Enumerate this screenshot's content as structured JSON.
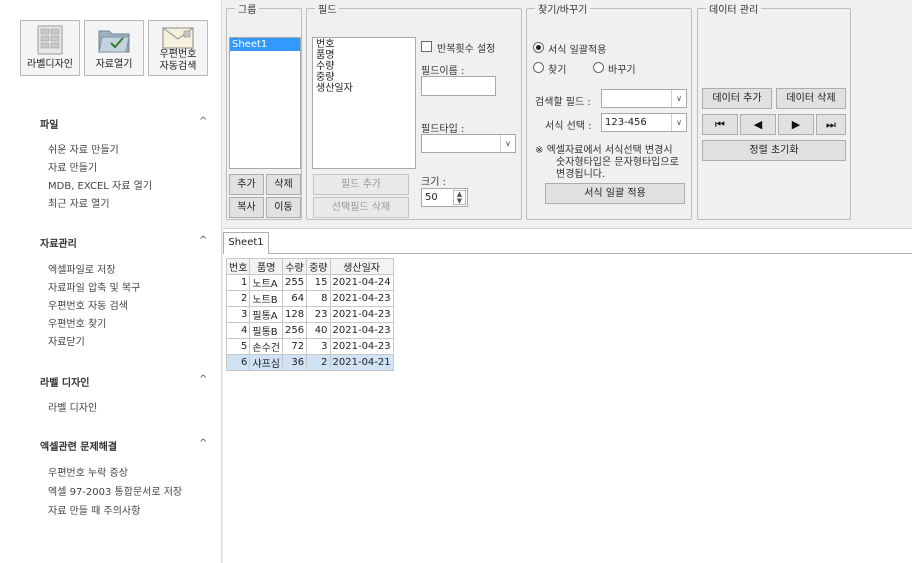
{
  "left_panel": {
    "top_buttons": [
      {
        "label": "라벨디자인",
        "icon": "label-grid-icon"
      },
      {
        "label": "자료열기",
        "icon": "folder-open-icon"
      },
      {
        "label_line1": "우편번호",
        "label_line2": "자동검색",
        "icon": "mail-envelope-icon"
      }
    ],
    "sections": [
      {
        "title": "파일",
        "caret": "^",
        "items": [
          "쉬운 자료 만들기",
          "자료 만들기",
          "MDB, EXCEL 자료 열기",
          "최근 자료 열기"
        ]
      },
      {
        "title": "자료관리",
        "caret": "^",
        "items": [
          "엑셀파일로 저장",
          "자료파일 압축 및 복구",
          "우편번호 자동 검색",
          "우편번호 찾기",
          "자료닫기"
        ]
      },
      {
        "title": "라벨 디자인",
        "caret": "^",
        "items": [
          "라벨 디자인"
        ]
      },
      {
        "title": "엑셀관련 문제해결",
        "caret": "^",
        "items": [
          "우편번호 누락 증상",
          "엑셀 97-2003 통합문서로 저장",
          "자료 만들 때 주의사항"
        ]
      }
    ]
  },
  "group": {
    "title": "그룹",
    "items": [
      "Sheet1"
    ],
    "buttons": {
      "add": "추가",
      "delete": "삭제",
      "copy": "복사",
      "move": "이동"
    }
  },
  "field": {
    "title": "필드",
    "items": [
      "번호",
      "품명",
      "수량",
      "중량",
      "생산일자"
    ],
    "repeat_label": "반복횟수 설정",
    "name_label": "필드이름 :",
    "name_value": "",
    "type_label": "필드타입 :",
    "type_value": "",
    "size_label": "크기 :",
    "size_value": "50",
    "add_button": "필드 추가",
    "delete_button": "선택필드 삭제"
  },
  "find_replace": {
    "title": "찾기/바꾸기",
    "radio_bulk": "서식 일괄적용",
    "radio_find": "찾기",
    "radio_replace": "바꾸기",
    "search_field_label": "검색할 필드 :",
    "search_field_value": "",
    "format_label": "서식 선택 :",
    "format_value": "123-456",
    "note_line1": "※ 엑셀자료에서 서식선택 변경시",
    "note_line2": "숫자형타입은 문자형타입으로",
    "note_line3": "변경됩니다.",
    "apply_button": "서식 일괄 적용"
  },
  "data_mgmt": {
    "title": "데이터 관리",
    "add_button": "데이터 추가",
    "delete_button": "데이터 삭제",
    "nav": [
      "⏮",
      "◀",
      "▶",
      "⏭"
    ],
    "reset_sort_button": "정렬 초기화"
  },
  "sheet": {
    "tab": "Sheet1",
    "columns": [
      "번호",
      "품명",
      "수량",
      "중량",
      "생산일자"
    ],
    "rows": [
      [
        "1",
        "노트A",
        "255",
        "15",
        "2021-04-24"
      ],
      [
        "2",
        "노트B",
        "64",
        "8",
        "2021-04-23"
      ],
      [
        "3",
        "필통A",
        "128",
        "23",
        "2021-04-23"
      ],
      [
        "4",
        "필통B",
        "256",
        "40",
        "2021-04-23"
      ],
      [
        "5",
        "손수건",
        "72",
        "3",
        "2021-04-23"
      ],
      [
        "6",
        "샤프심",
        "36",
        "2",
        "2021-04-21"
      ]
    ]
  },
  "colors": {
    "selection": "#cfe3f5",
    "list_selection": "#3399ff"
  }
}
